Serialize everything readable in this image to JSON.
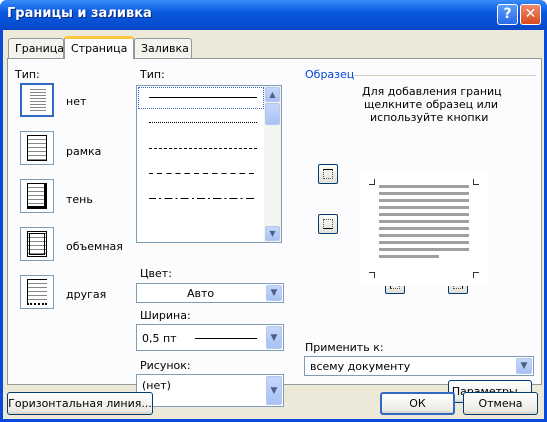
{
  "dialog": {
    "title": "Границы и заливка",
    "help": "?",
    "close": "✕"
  },
  "tabs": [
    {
      "label": "Граница"
    },
    {
      "label": "Страница"
    },
    {
      "label": "Заливка"
    }
  ],
  "settings": {
    "type_label": "Тип:",
    "items": [
      {
        "label": "нет"
      },
      {
        "label": "рамка"
      },
      {
        "label": "тень"
      },
      {
        "label": "объемная"
      },
      {
        "label": "другая"
      }
    ]
  },
  "style": {
    "label": "Тип:"
  },
  "color": {
    "label": "Цвет:",
    "value": "Авто"
  },
  "width": {
    "label": "Ширина:",
    "value": "0,5 пт"
  },
  "art": {
    "label": "Рисунок:",
    "value": "(нет)"
  },
  "preview": {
    "label": "Образец",
    "hint_line1": "Для добавления границ",
    "hint_line2": "щелкните образец или",
    "hint_line3": "используйте кнопки"
  },
  "apply": {
    "label": "Применить к:",
    "value": "всему документу"
  },
  "buttons": {
    "options": "Параметры...",
    "horizontal_line": "Горизонтальная линия...",
    "ok": "ОК",
    "cancel": "Отмена"
  }
}
